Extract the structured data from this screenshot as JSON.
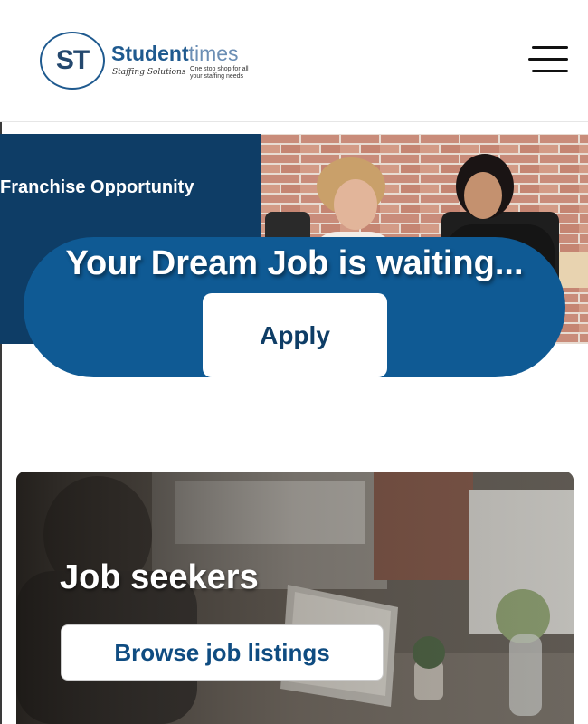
{
  "header": {
    "logo_initials": "ST",
    "brand_primary": "Student",
    "brand_secondary": "times",
    "tagline_script": "Staffing Solutions",
    "tagline_small": "One stop shop for all your staffing needs",
    "menu_icon": "hamburger-menu-icon"
  },
  "hero": {
    "overlay_text": "Franchise Opportunity",
    "headline": "Your Dream Job is waiting...",
    "apply_label": "Apply"
  },
  "job_seekers": {
    "title": "Job seekers",
    "button_label": "Browse job listings"
  },
  "colors": {
    "brand_blue": "#1f5a8f",
    "hero_navy": "#0e3d66",
    "pill_blue": "#0f5a94",
    "button_text": "#0f4c81"
  }
}
